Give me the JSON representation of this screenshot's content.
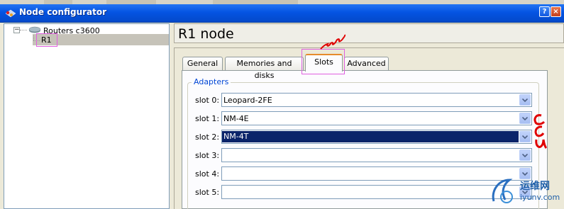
{
  "window": {
    "title": "Node configurator",
    "help_btn": "?",
    "close_btn": "×"
  },
  "tree": {
    "root": {
      "label": "Routers c3600",
      "expander": "−"
    },
    "items": [
      {
        "label": "R1",
        "selected": true
      }
    ]
  },
  "node_title": "R1 node",
  "tabs": [
    {
      "label": "General",
      "active": false
    },
    {
      "label": "Memories and disks",
      "active": false
    },
    {
      "label": "Slots",
      "active": true
    },
    {
      "label": "Advanced",
      "active": false
    }
  ],
  "adapters": {
    "title": "Adapters",
    "slots": [
      {
        "label": "slot 0:",
        "value": "Leopard-2FE",
        "selected": false
      },
      {
        "label": "slot 1:",
        "value": "NM-4E",
        "selected": false
      },
      {
        "label": "slot 2:",
        "value": "NM-4T",
        "selected": true
      },
      {
        "label": "slot 3:",
        "value": "",
        "selected": false
      },
      {
        "label": "slot 4:",
        "value": "",
        "selected": false
      },
      {
        "label": "slot 5:",
        "value": "",
        "selected": false
      }
    ]
  },
  "watermark": {
    "site": "运维网",
    "url": "iyunv.com"
  },
  "colors": {
    "titlebar": "#0554e3",
    "selection": "#0a246a",
    "highlight_box": "#e060e0",
    "annotation": "#e00000",
    "group_title": "#0046d5"
  }
}
